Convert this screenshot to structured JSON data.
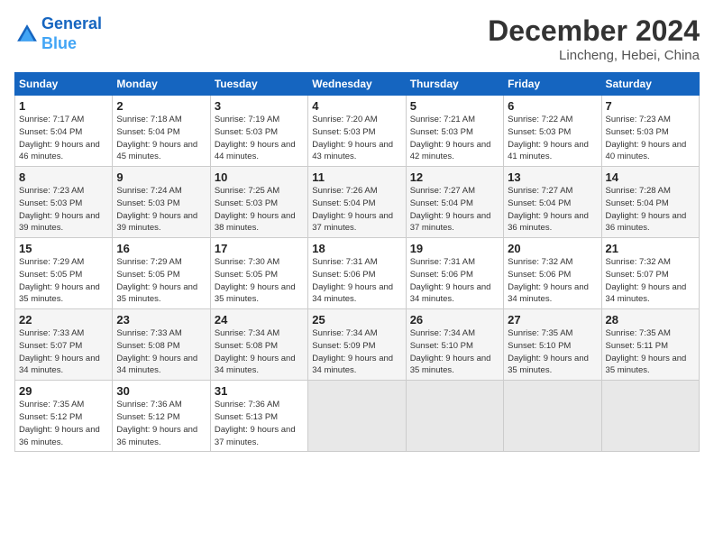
{
  "header": {
    "logo_line1": "General",
    "logo_line2": "Blue",
    "month_year": "December 2024",
    "location": "Lincheng, Hebei, China"
  },
  "weekdays": [
    "Sunday",
    "Monday",
    "Tuesday",
    "Wednesday",
    "Thursday",
    "Friday",
    "Saturday"
  ],
  "weeks": [
    [
      {
        "day": "1",
        "sunrise": "Sunrise: 7:17 AM",
        "sunset": "Sunset: 5:04 PM",
        "daylight": "Daylight: 9 hours and 46 minutes."
      },
      {
        "day": "2",
        "sunrise": "Sunrise: 7:18 AM",
        "sunset": "Sunset: 5:04 PM",
        "daylight": "Daylight: 9 hours and 45 minutes."
      },
      {
        "day": "3",
        "sunrise": "Sunrise: 7:19 AM",
        "sunset": "Sunset: 5:03 PM",
        "daylight": "Daylight: 9 hours and 44 minutes."
      },
      {
        "day": "4",
        "sunrise": "Sunrise: 7:20 AM",
        "sunset": "Sunset: 5:03 PM",
        "daylight": "Daylight: 9 hours and 43 minutes."
      },
      {
        "day": "5",
        "sunrise": "Sunrise: 7:21 AM",
        "sunset": "Sunset: 5:03 PM",
        "daylight": "Daylight: 9 hours and 42 minutes."
      },
      {
        "day": "6",
        "sunrise": "Sunrise: 7:22 AM",
        "sunset": "Sunset: 5:03 PM",
        "daylight": "Daylight: 9 hours and 41 minutes."
      },
      {
        "day": "7",
        "sunrise": "Sunrise: 7:23 AM",
        "sunset": "Sunset: 5:03 PM",
        "daylight": "Daylight: 9 hours and 40 minutes."
      }
    ],
    [
      {
        "day": "8",
        "sunrise": "Sunrise: 7:23 AM",
        "sunset": "Sunset: 5:03 PM",
        "daylight": "Daylight: 9 hours and 39 minutes."
      },
      {
        "day": "9",
        "sunrise": "Sunrise: 7:24 AM",
        "sunset": "Sunset: 5:03 PM",
        "daylight": "Daylight: 9 hours and 39 minutes."
      },
      {
        "day": "10",
        "sunrise": "Sunrise: 7:25 AM",
        "sunset": "Sunset: 5:03 PM",
        "daylight": "Daylight: 9 hours and 38 minutes."
      },
      {
        "day": "11",
        "sunrise": "Sunrise: 7:26 AM",
        "sunset": "Sunset: 5:04 PM",
        "daylight": "Daylight: 9 hours and 37 minutes."
      },
      {
        "day": "12",
        "sunrise": "Sunrise: 7:27 AM",
        "sunset": "Sunset: 5:04 PM",
        "daylight": "Daylight: 9 hours and 37 minutes."
      },
      {
        "day": "13",
        "sunrise": "Sunrise: 7:27 AM",
        "sunset": "Sunset: 5:04 PM",
        "daylight": "Daylight: 9 hours and 36 minutes."
      },
      {
        "day": "14",
        "sunrise": "Sunrise: 7:28 AM",
        "sunset": "Sunset: 5:04 PM",
        "daylight": "Daylight: 9 hours and 36 minutes."
      }
    ],
    [
      {
        "day": "15",
        "sunrise": "Sunrise: 7:29 AM",
        "sunset": "Sunset: 5:05 PM",
        "daylight": "Daylight: 9 hours and 35 minutes."
      },
      {
        "day": "16",
        "sunrise": "Sunrise: 7:29 AM",
        "sunset": "Sunset: 5:05 PM",
        "daylight": "Daylight: 9 hours and 35 minutes."
      },
      {
        "day": "17",
        "sunrise": "Sunrise: 7:30 AM",
        "sunset": "Sunset: 5:05 PM",
        "daylight": "Daylight: 9 hours and 35 minutes."
      },
      {
        "day": "18",
        "sunrise": "Sunrise: 7:31 AM",
        "sunset": "Sunset: 5:06 PM",
        "daylight": "Daylight: 9 hours and 34 minutes."
      },
      {
        "day": "19",
        "sunrise": "Sunrise: 7:31 AM",
        "sunset": "Sunset: 5:06 PM",
        "daylight": "Daylight: 9 hours and 34 minutes."
      },
      {
        "day": "20",
        "sunrise": "Sunrise: 7:32 AM",
        "sunset": "Sunset: 5:06 PM",
        "daylight": "Daylight: 9 hours and 34 minutes."
      },
      {
        "day": "21",
        "sunrise": "Sunrise: 7:32 AM",
        "sunset": "Sunset: 5:07 PM",
        "daylight": "Daylight: 9 hours and 34 minutes."
      }
    ],
    [
      {
        "day": "22",
        "sunrise": "Sunrise: 7:33 AM",
        "sunset": "Sunset: 5:07 PM",
        "daylight": "Daylight: 9 hours and 34 minutes."
      },
      {
        "day": "23",
        "sunrise": "Sunrise: 7:33 AM",
        "sunset": "Sunset: 5:08 PM",
        "daylight": "Daylight: 9 hours and 34 minutes."
      },
      {
        "day": "24",
        "sunrise": "Sunrise: 7:34 AM",
        "sunset": "Sunset: 5:08 PM",
        "daylight": "Daylight: 9 hours and 34 minutes."
      },
      {
        "day": "25",
        "sunrise": "Sunrise: 7:34 AM",
        "sunset": "Sunset: 5:09 PM",
        "daylight": "Daylight: 9 hours and 34 minutes."
      },
      {
        "day": "26",
        "sunrise": "Sunrise: 7:34 AM",
        "sunset": "Sunset: 5:10 PM",
        "daylight": "Daylight: 9 hours and 35 minutes."
      },
      {
        "day": "27",
        "sunrise": "Sunrise: 7:35 AM",
        "sunset": "Sunset: 5:10 PM",
        "daylight": "Daylight: 9 hours and 35 minutes."
      },
      {
        "day": "28",
        "sunrise": "Sunrise: 7:35 AM",
        "sunset": "Sunset: 5:11 PM",
        "daylight": "Daylight: 9 hours and 35 minutes."
      }
    ],
    [
      {
        "day": "29",
        "sunrise": "Sunrise: 7:35 AM",
        "sunset": "Sunset: 5:12 PM",
        "daylight": "Daylight: 9 hours and 36 minutes."
      },
      {
        "day": "30",
        "sunrise": "Sunrise: 7:36 AM",
        "sunset": "Sunset: 5:12 PM",
        "daylight": "Daylight: 9 hours and 36 minutes."
      },
      {
        "day": "31",
        "sunrise": "Sunrise: 7:36 AM",
        "sunset": "Sunset: 5:13 PM",
        "daylight": "Daylight: 9 hours and 37 minutes."
      },
      null,
      null,
      null,
      null
    ]
  ]
}
